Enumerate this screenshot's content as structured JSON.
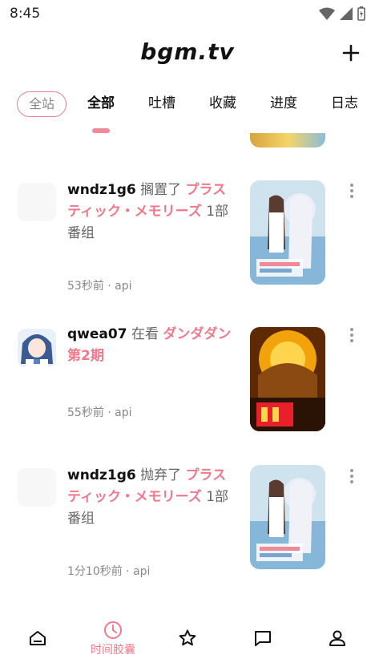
{
  "status": {
    "time": "8:45"
  },
  "app": {
    "logo": "bgm.tv"
  },
  "tabs": [
    {
      "label": "全站",
      "style": "pill"
    },
    {
      "label": "全部",
      "active": true
    },
    {
      "label": "吐槽"
    },
    {
      "label": "收藏"
    },
    {
      "label": "进度"
    },
    {
      "label": "日志"
    }
  ],
  "feed": [
    {
      "user": "wndz1g6",
      "action": "搁置了",
      "subject": "プラスティック・メモリーズ",
      "suffix": "1部番组",
      "meta": "53秒前 · api",
      "cover": "plastic-memories-cover",
      "avatar": "blank"
    },
    {
      "user": "qwea07",
      "action": "在看",
      "subject": "ダンダダン 第2期",
      "suffix": "",
      "meta": "55秒前 · api",
      "cover": "dandadan-cover",
      "avatar": "anime-avatar"
    },
    {
      "user": "wndz1g6",
      "action": "抛弃了",
      "subject": "プラスティック・メモリーズ",
      "suffix": "1部番组",
      "meta": "1分10秒前 · api",
      "cover": "plastic-memories-cover",
      "avatar": "blank"
    }
  ],
  "bottom_nav": [
    {
      "icon": "home-icon",
      "label": ""
    },
    {
      "icon": "clock-icon",
      "label": "时间胶囊",
      "active": true
    },
    {
      "icon": "star-icon",
      "label": ""
    },
    {
      "icon": "chat-icon",
      "label": ""
    },
    {
      "icon": "user-icon",
      "label": ""
    }
  ],
  "colors": {
    "accent": "#f0798c",
    "text": "#111111",
    "muted": "#888888"
  }
}
